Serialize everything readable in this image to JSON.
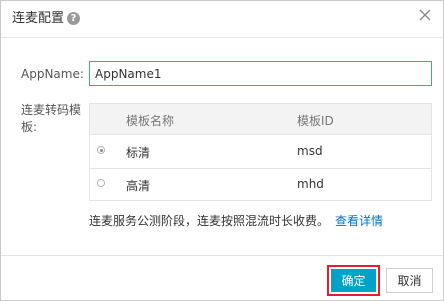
{
  "dialog": {
    "title": "连麦配置",
    "help_icon": "question-circle-icon",
    "close_icon": "close-icon"
  },
  "form": {
    "app_name_label": "AppName:",
    "app_name_value": "AppName1",
    "template_label": "连麦转码模板:"
  },
  "templates": {
    "columns": [
      "模板名称",
      "模板ID"
    ],
    "rows": [
      {
        "name": "标清",
        "id": "msd",
        "selected": true
      },
      {
        "name": "高清",
        "id": "mhd",
        "selected": false
      }
    ]
  },
  "note": {
    "text": "连麦服务公测阶段，连麦按照混流时长收费。",
    "link": "查看详情"
  },
  "buttons": {
    "ok": "确定",
    "cancel": "取消"
  },
  "colors": {
    "primary": "#00a2ca",
    "link": "#0070cc",
    "highlight_border": "#e0202e",
    "input_focus": "#3cb371"
  }
}
